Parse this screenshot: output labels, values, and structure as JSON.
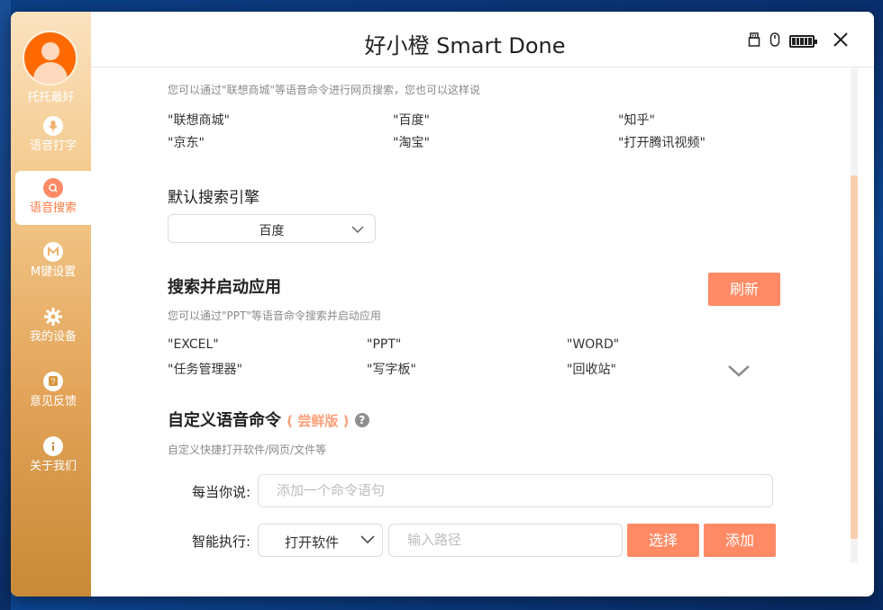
{
  "app": {
    "title": "好小橙 Smart Done"
  },
  "user": {
    "name": "托托最好"
  },
  "sidebar": {
    "items": [
      {
        "label": "语音打字"
      },
      {
        "label": "语音搜索"
      },
      {
        "label": "M键设置"
      },
      {
        "label": "我的设备"
      },
      {
        "label": "意见反馈"
      },
      {
        "label": "关于我们"
      }
    ]
  },
  "web_search": {
    "desc": "您可以通过\"联想商城\"等语音命令进行网页搜索，您也可以这样说",
    "examples": [
      "\"联想商城\"",
      "\"百度\"",
      "\"知乎\"",
      "\"京东\"",
      "\"淘宝\"",
      "\"打开腾讯视频\""
    ]
  },
  "engine": {
    "label": "默认搜索引擎",
    "selected": "百度"
  },
  "apps": {
    "title": "搜索并启动应用",
    "refresh": "刷新",
    "desc": "您可以通过\"PPT\"等语音命令搜索并启动应用",
    "examples": [
      "\"EXCEL\"",
      "\"PPT\"",
      "\"WORD\"",
      "\"任务管理器\"",
      "\"写字板\"",
      "\"回收站\""
    ]
  },
  "custom": {
    "title": "自定义语音命令",
    "badge": "( 尝鲜版 )",
    "help": "?",
    "desc": "自定义快捷打开软件/网页/文件等",
    "when_label": "每当你说:",
    "when_placeholder": "添加一个命令语句",
    "exec_label": "智能执行:",
    "exec_selected": "打开软件",
    "path_placeholder": "输入路径",
    "choose": "选择",
    "add": "添加"
  },
  "colors": {
    "accent": "#ff8a65",
    "badge": "#ff9f7a"
  },
  "icons": {
    "usb": "usb-icon",
    "mouse": "mouse-icon",
    "battery": "battery-icon",
    "close": "close-icon",
    "mic": "mic-icon",
    "search": "search-icon",
    "m": "m-key-icon",
    "gear": "gear-icon",
    "feedback": "feedback-icon",
    "info": "info-icon",
    "chevron": "chevron-down-icon"
  }
}
